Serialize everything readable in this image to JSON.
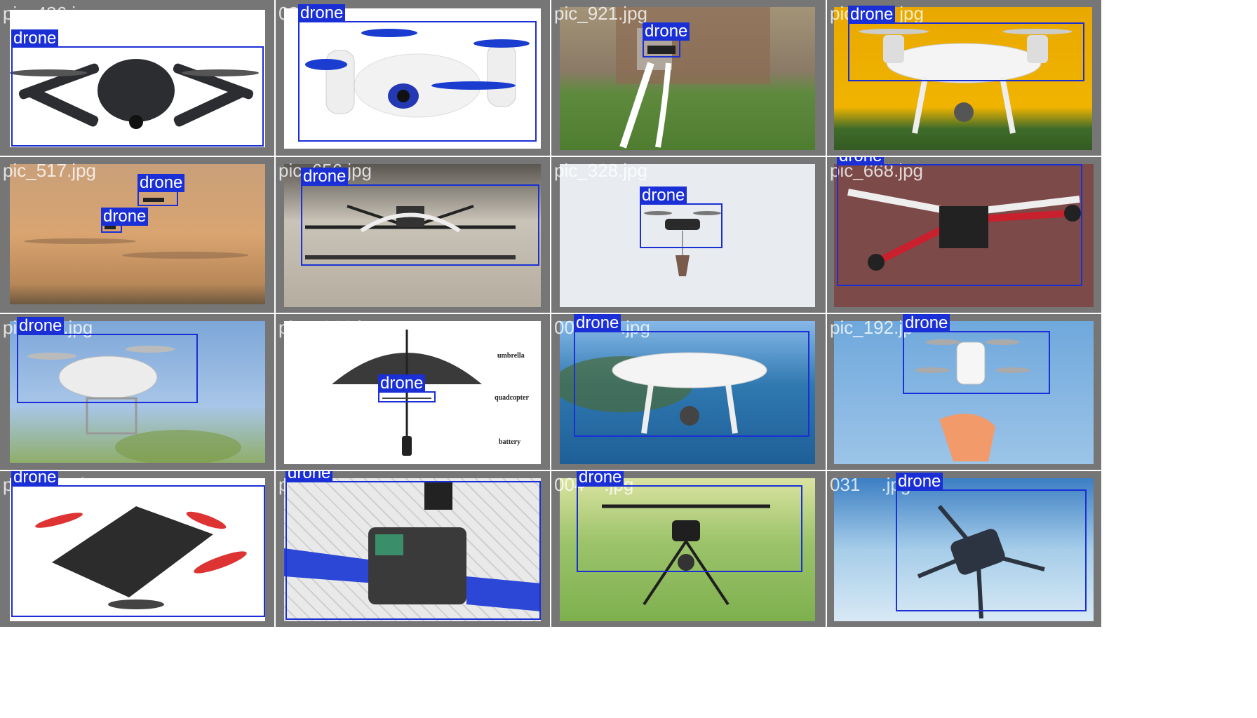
{
  "mosaic": {
    "cells": [
      {
        "filename": "pic_436.jpg",
        "detections": [
          {
            "label": "drone"
          }
        ]
      },
      {
        "filename": "03",
        "detections": [
          {
            "label": "drone"
          }
        ]
      },
      {
        "filename": "pic_921.jpg",
        "detections": [
          {
            "label": "drone"
          }
        ]
      },
      {
        "filename": "pic",
        "detections": [
          {
            "label": "drone"
          }
        ],
        "filename_tail": "jpg"
      },
      {
        "filename": "pic_517.jpg",
        "detections": [
          {
            "label": "drone"
          },
          {
            "label": "drone"
          }
        ]
      },
      {
        "filename": "pic_656.jpg",
        "detections": [
          {
            "label": "drone"
          }
        ]
      },
      {
        "filename": "pic_328.jpg",
        "detections": [
          {
            "label": "drone"
          }
        ]
      },
      {
        "filename": "pic_668.jpg",
        "detections": [
          {
            "label": "drone"
          }
        ]
      },
      {
        "filename": "pi",
        "detections": [
          {
            "label": "drone"
          }
        ],
        "filename_tail": ".jpg"
      },
      {
        "filename": "pic_1036.jpg",
        "detections": [
          {
            "label": "drone"
          }
        ],
        "annotations": [
          "umbrella",
          "quadcopter",
          "battery"
        ]
      },
      {
        "filename": "00",
        "detections": [
          {
            "label": "drone"
          }
        ],
        "filename_tail": ".jpg"
      },
      {
        "filename": "pic_192.jp",
        "detections": [
          {
            "label": "drone"
          }
        ]
      },
      {
        "filename": "pic_1135.jpg",
        "detections": [
          {
            "label": "drone"
          }
        ]
      },
      {
        "filename": "p",
        "detections": [
          {
            "label": "drone"
          }
        ]
      },
      {
        "filename": "004",
        "detections": [
          {
            "label": "drone"
          }
        ],
        "filename_tail": ".jpg"
      },
      {
        "filename": "031",
        "detections": [
          {
            "label": "drone"
          }
        ],
        "filename_tail": ".jpg"
      }
    ]
  },
  "colors": {
    "bbox": "#1a2fd6",
    "label_text": "#ffffff",
    "cell_border": "#767676"
  }
}
